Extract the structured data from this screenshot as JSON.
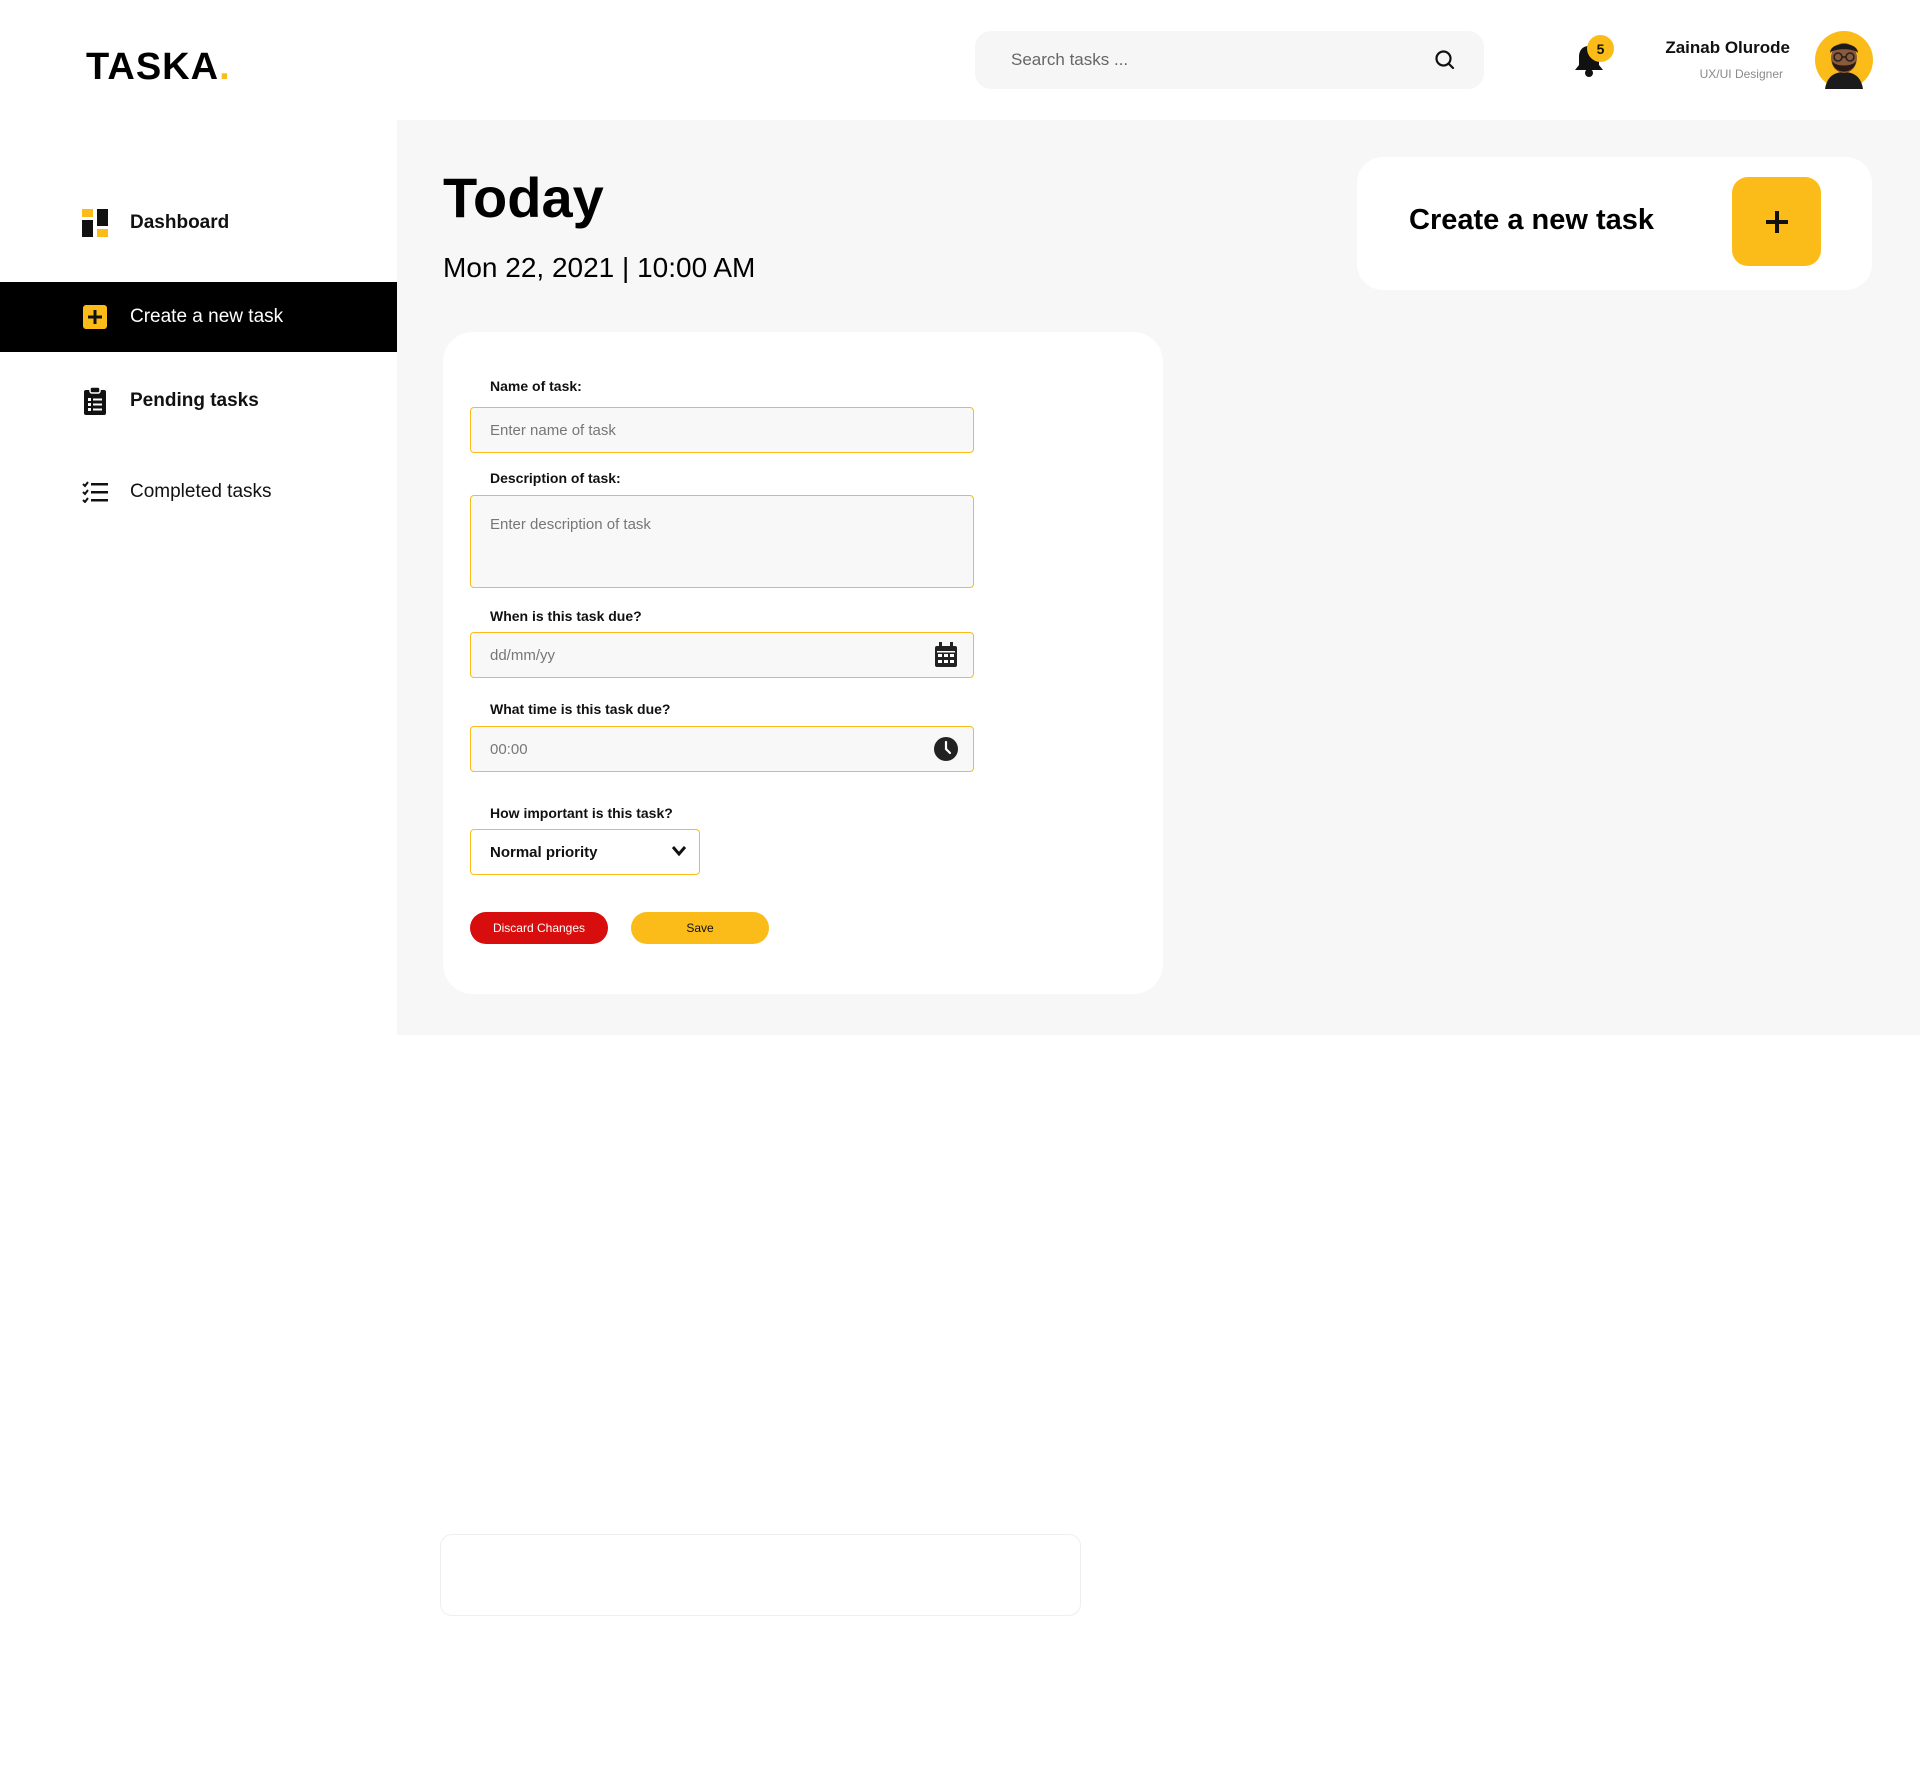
{
  "brand": {
    "name": "TASKA",
    "dot": ".",
    "accent": "#FBBC1A"
  },
  "header": {
    "search": {
      "placeholder": "Search tasks ...",
      "icon": "search-icon"
    },
    "notifications": {
      "count": "5",
      "icon": "bell-icon"
    },
    "user": {
      "name": "Zainab Olurode",
      "role": "UX/UI Designer",
      "avatar": "avatar-illustration"
    }
  },
  "sidebar": {
    "items": [
      {
        "label": "Dashboard",
        "icon": "dashboard-icon",
        "active": false
      },
      {
        "label": "Create a new task",
        "icon": "plus-square-icon",
        "active": true
      },
      {
        "label": "Pending tasks",
        "icon": "clipboard-icon",
        "active": false
      },
      {
        "label": "Completed tasks",
        "icon": "checklist-icon",
        "active": false
      }
    ]
  },
  "main": {
    "title": "Today",
    "date": "Mon 22, 2021 | 10:00 AM",
    "create_card": {
      "label": "Create a new task",
      "button": "+"
    }
  },
  "form": {
    "name": {
      "label": "Name of task:",
      "placeholder": "Enter name of task",
      "value": ""
    },
    "description": {
      "label": "Description of task:",
      "placeholder": "Enter description of task",
      "value": ""
    },
    "due_date": {
      "label": "When is this task due?",
      "placeholder": "dd/mm/yy",
      "icon": "calendar-icon"
    },
    "due_time": {
      "label": "What time is this task due?",
      "placeholder": "00:00",
      "icon": "clock-icon"
    },
    "priority": {
      "label": "How important is this task?",
      "selected": "Normal priority",
      "icon": "chevron-down-icon"
    },
    "discard_label": "Discard Changes",
    "save_label": "Save"
  },
  "colors": {
    "accent": "#FBBC1A",
    "danger": "#D80E0E",
    "active_nav_bg": "#000000",
    "panel_bg": "#F7F7F7"
  }
}
